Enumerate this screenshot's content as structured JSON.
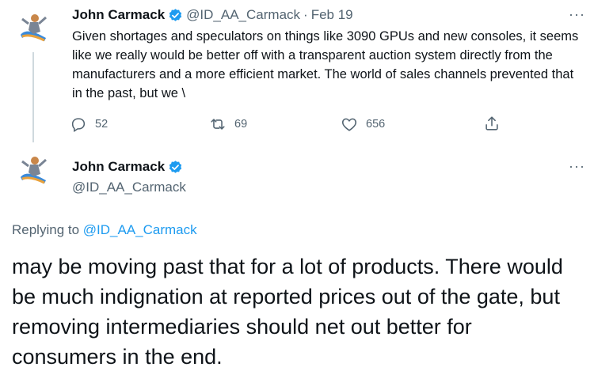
{
  "tweet1": {
    "display_name": "John Carmack",
    "handle": "@ID_AA_Carmack",
    "separator": "·",
    "date": "Feb 19",
    "more": "···",
    "text": "Given shortages and speculators on things like 3090 GPUs and new consoles, it seems like we really would be better off with a transparent auction system directly from the manufacturers and a more efficient market. The world of sales channels prevented that in the past, but we \\",
    "replies": "52",
    "retweets": "69",
    "likes": "656"
  },
  "tweet2": {
    "display_name": "John Carmack",
    "handle": "@ID_AA_Carmack",
    "more": "···",
    "replying_prefix": "Replying to ",
    "replying_to": "@ID_AA_Carmack",
    "text": "may be moving past that for a lot of products. There would be much indignation at reported prices out of the gate, but removing intermediaries should net out better for consumers in the end."
  },
  "colors": {
    "accent": "#1d9bf0",
    "muted": "#536471",
    "text": "#0f1419",
    "thread_line": "#cfd9de"
  },
  "icons": [
    "reply-icon",
    "retweet-icon",
    "like-icon",
    "share-icon",
    "verified-icon",
    "more-icon"
  ]
}
